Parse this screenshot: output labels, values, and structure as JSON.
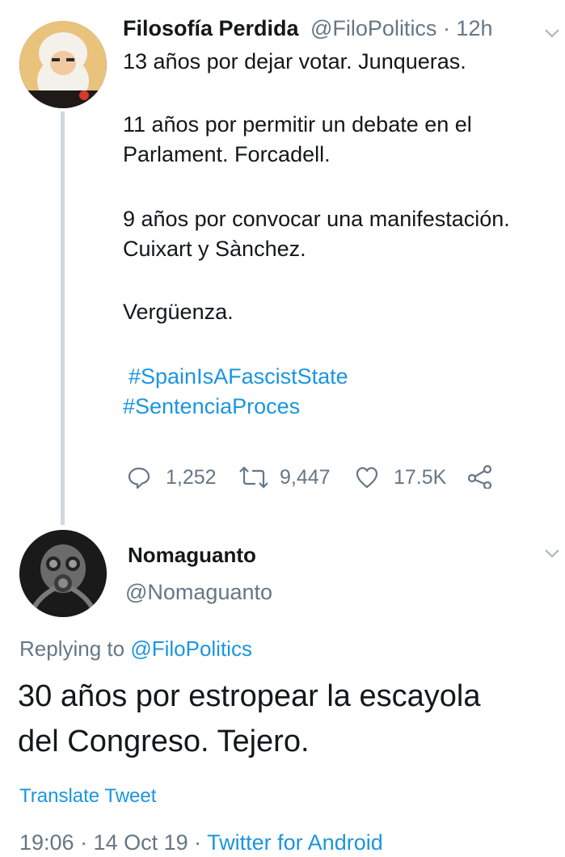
{
  "tweet": {
    "author_name": "Filosofía Perdida",
    "author_handle": "@FiloPolitics · 12h",
    "lines": [
      "13 años por dejar votar. Junqueras.",
      "11 años por permitir un debate en el",
      "Parlament. Forcadell.",
      "9 años por convocar una manifestación.",
      "Cuixart y Sànchez.",
      "Vergüenza."
    ],
    "hashtags": [
      "#SpainIsAFascistState",
      "#SentenciaProces"
    ],
    "actions": {
      "reply_count": "1,252",
      "retweet_count": "9,447",
      "like_count": "17.5K"
    }
  },
  "reply": {
    "author_name": "Nomaguanto",
    "author_handle": "@Nomaguanto",
    "replying_prefix": "Replying to",
    "replying_to": "@FiloPolitics",
    "lines": [
      "30 años por estropear la escayola",
      "del Congreso. Tejero."
    ],
    "translate_label": "Translate Tweet",
    "timestamp": "19:06 · 14 Oct 19 · ",
    "source": "Twitter for Android"
  },
  "colors": {
    "link": "#1b95e0",
    "muted": "#657786",
    "text": "#14171a",
    "thread_line": "#cfd9de"
  }
}
